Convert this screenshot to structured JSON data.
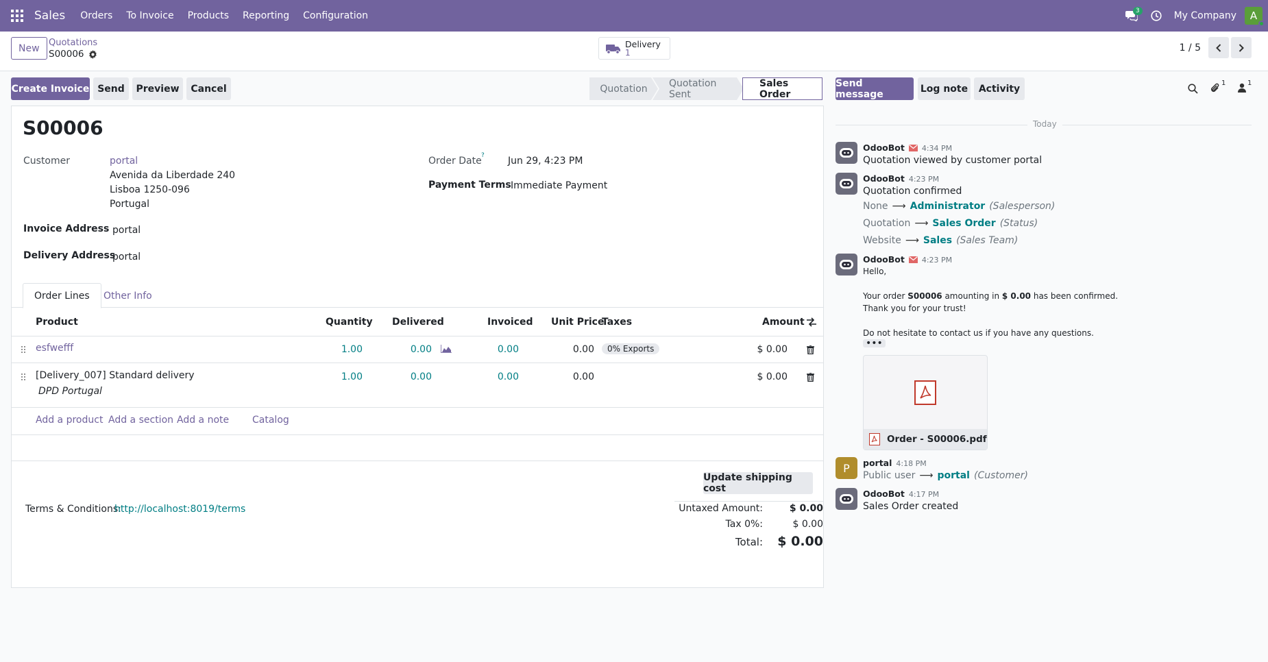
{
  "navbar": {
    "app_name": "Sales",
    "menu": [
      "Orders",
      "To Invoice",
      "Products",
      "Reporting",
      "Configuration"
    ],
    "messages_badge": "3",
    "company": "My Company",
    "avatar_letter": "A",
    "accent": "#71639e"
  },
  "control_panel": {
    "new_label": "New",
    "breadcrumb_parent": "Quotations",
    "breadcrumb_current": "S00006",
    "delivery_label": "Delivery",
    "delivery_count": "1",
    "pager": "1 / 5"
  },
  "actions": {
    "create_invoice": "Create Invoice",
    "send": "Send",
    "preview": "Preview",
    "cancel": "Cancel"
  },
  "statusbar": [
    "Quotation",
    "Quotation Sent",
    "Sales Order"
  ],
  "statusbar_active": "Sales Order",
  "form": {
    "name": "S00006",
    "customer_label": "Customer",
    "customer_name": "portal",
    "address_line1": "Avenida da Liberdade 240",
    "address_line2": "Lisboa 1250-096",
    "address_line3": "Portugal",
    "invoice_address_label": "Invoice Address",
    "invoice_address": "portal",
    "delivery_address_label": "Delivery Address",
    "delivery_address": "portal",
    "order_date_label": "Order Date",
    "order_date_help": "?",
    "order_date": "Jun 29, 4:23 PM",
    "payment_terms_label": "Payment Terms",
    "payment_terms": "Immediate Payment"
  },
  "tabs": [
    "Order Lines",
    "Other Info"
  ],
  "table": {
    "headers": {
      "product": "Product",
      "quantity": "Quantity",
      "delivered": "Delivered",
      "invoiced": "Invoiced",
      "unit_price": "Unit Price",
      "taxes": "Taxes",
      "amount": "Amount"
    },
    "rows": [
      {
        "product": "esfwefff",
        "quantity": "1.00",
        "delivered": "0.00",
        "invoiced": "0.00",
        "unit_price": "0.00",
        "tax": "0% Exports",
        "amount": "$ 0.00"
      },
      {
        "product": "[Delivery_007] Standard delivery",
        "note": "DPD Portugal",
        "quantity": "1.00",
        "delivered": "0.00",
        "invoiced": "0.00",
        "unit_price": "0.00",
        "tax": "",
        "amount": "$ 0.00"
      }
    ],
    "add_product": "Add a product",
    "add_section": "Add a section",
    "add_note": "Add a note",
    "catalog": "Catalog"
  },
  "footer": {
    "update_shipping": "Update shipping cost",
    "terms_label": "Terms & Conditions:",
    "terms_link": "http://localhost:8019/terms",
    "untaxed_label": "Untaxed Amount:",
    "untaxed_value": "$ 0.00",
    "tax_label": "Tax 0%:",
    "tax_value": "$ 0.00",
    "total_label": "Total:",
    "total_value": "$ 0.00"
  },
  "chatter": {
    "send_message": "Send message",
    "log_note": "Log note",
    "activity": "Activity",
    "attachments_count": "1",
    "followers_count": "1",
    "date_separator": "Today",
    "messages": [
      {
        "author": "OdooBot",
        "time": "4:34 PM",
        "body": "Quotation viewed by customer portal"
      },
      {
        "author": "OdooBot",
        "time": "4:23 PM",
        "body": "Quotation confirmed",
        "tracking": [
          {
            "old": "None",
            "new": "Administrator",
            "field": "(Salesperson)"
          },
          {
            "old": "Quotation",
            "new": "Sales Order",
            "field": "(Status)"
          },
          {
            "old": "Website",
            "new": "Sales",
            "field": "(Sales Team)"
          }
        ]
      },
      {
        "author": "OdooBot",
        "time": "4:23 PM",
        "greeting": "Hello,",
        "line1_pre": "Your order ",
        "line1_order": "S00006",
        "line1_mid": " amounting in ",
        "line1_amount": "$ 0.00",
        "line1_post": " has been confirmed.",
        "line2": "Thank you for your trust!",
        "line3": "Do not hesitate to contact us if you have any questions.",
        "attachment": "Order - S00006.pdf"
      },
      {
        "author": "portal",
        "author_initial": "P",
        "time": "4:18 PM",
        "tracking": [
          {
            "old": "Public user",
            "new": "portal",
            "field": "(Customer)"
          }
        ]
      },
      {
        "author": "OdooBot",
        "time": "4:17 PM",
        "body": "Sales Order created"
      }
    ]
  }
}
